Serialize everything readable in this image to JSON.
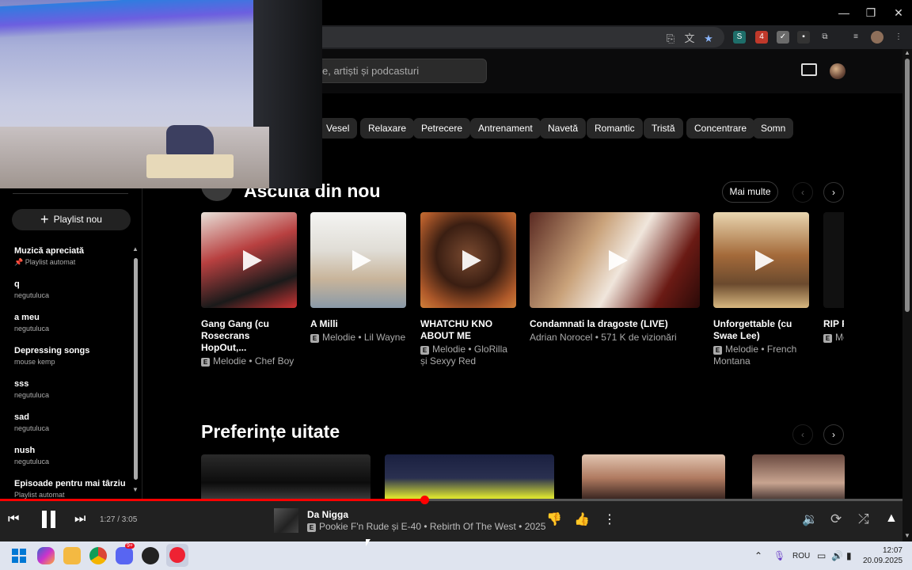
{
  "browser": {
    "window_controls": [
      "—",
      "❐",
      "✕"
    ]
  },
  "header": {
    "search_placeholder": "e, artiști și podcasturi"
  },
  "chips": [
    "Vesel",
    "Relaxare",
    "Petrecere",
    "Antrenament",
    "Navetă",
    "Romantic",
    "Tristă",
    "Concentrare",
    "Somn"
  ],
  "sidebar": {
    "new_playlist": "Playlist nou",
    "playlists": [
      {
        "title": "Muzică apreciată",
        "subtitle": "Playlist automat",
        "pinned": true
      },
      {
        "title": "q",
        "subtitle": "negutuluca"
      },
      {
        "title": "a meu",
        "subtitle": "negutuluca"
      },
      {
        "title": "Depressing songs",
        "subtitle": "mouse kemp"
      },
      {
        "title": "sss",
        "subtitle": "negutuluca"
      },
      {
        "title": "sad",
        "subtitle": "negutuluca"
      },
      {
        "title": "nush",
        "subtitle": "negutuluca"
      },
      {
        "title": "Episoade pentru mai târziu",
        "subtitle": "Playlist automat"
      }
    ]
  },
  "main": {
    "section1": {
      "title": "Ascultă din nou",
      "more": "Mai multe",
      "cards": [
        {
          "title": "Gang Gang (cu Rosecrans HopOut,...",
          "explicit": true,
          "subtitle": "Melodie • Chef Boy"
        },
        {
          "title": "A Milli",
          "explicit": true,
          "subtitle": "Melodie • Lil Wayne"
        },
        {
          "title": "WHATCHU KNO ABOUT ME",
          "explicit": true,
          "subtitle": "Melodie • GloRilla și Sexyy Red"
        },
        {
          "title": "Condamnati la dragoste (LIVE)",
          "explicit": false,
          "subtitle": "Adrian Norocel • 571 K de vizionări"
        },
        {
          "title": "Unforgettable (cu Swae Lee)",
          "explicit": true,
          "subtitle": "Melodie • French Montana"
        },
        {
          "title": "RIP R Mask",
          "explicit": true,
          "subtitle": "Me XXXT"
        }
      ]
    },
    "section2": {
      "title": "Preferințe uitate"
    }
  },
  "player": {
    "time": "1:27 / 3:05",
    "progress": 0.47,
    "track_title": "Da Nigga",
    "track_explicit": true,
    "track_subtitle": "Pookie F'n Rude și E-40 • Rebirth Of The West • 2025"
  },
  "taskbar": {
    "language": "ROU",
    "time": "12:07",
    "date": "20.09.2025",
    "discord_badge": "9+"
  },
  "colors": {
    "accent_red": "#ff0000",
    "chip_bg": "#272727",
    "background": "#030303"
  }
}
